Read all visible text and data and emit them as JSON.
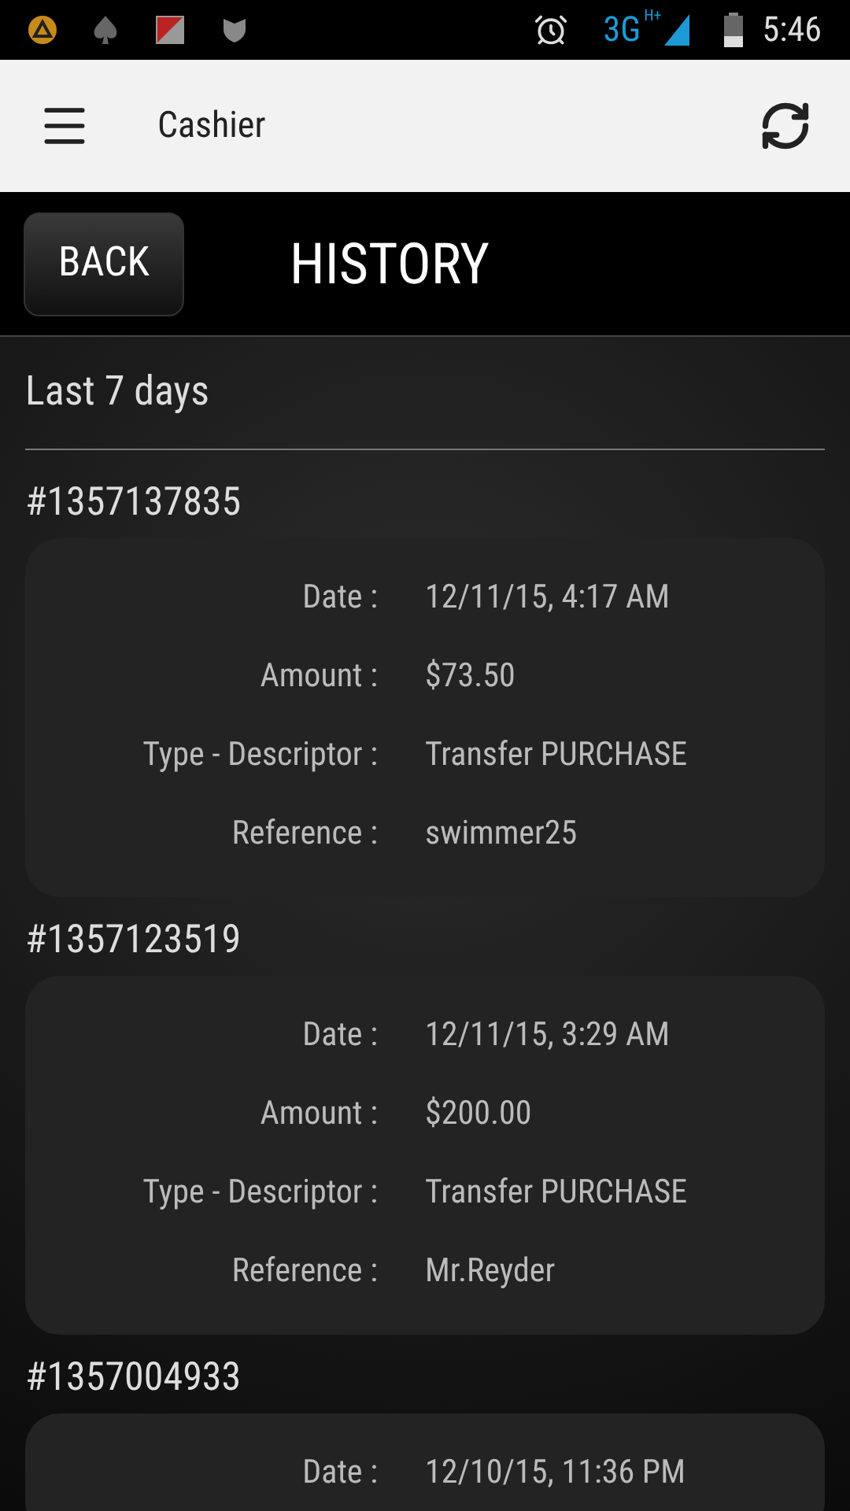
{
  "status_bar": {
    "network": "3G",
    "network_sub": "H+",
    "time": "5:46"
  },
  "app_bar": {
    "title": "Cashier"
  },
  "header": {
    "back": "BACK",
    "title": "HISTORY"
  },
  "section": "Last 7 days",
  "transactions": [
    {
      "id": "#1357137835",
      "fields": [
        {
          "label": "Date :",
          "value": "12/11/15, 4:17 AM"
        },
        {
          "label": "Amount :",
          "value": "$73.50"
        },
        {
          "label": "Type - Descriptor :",
          "value": "Transfer PURCHASE"
        },
        {
          "label": "Reference :",
          "value": "swimmer25"
        }
      ]
    },
    {
      "id": "#1357123519",
      "fields": [
        {
          "label": "Date :",
          "value": "12/11/15, 3:29 AM"
        },
        {
          "label": "Amount :",
          "value": "$200.00"
        },
        {
          "label": "Type - Descriptor :",
          "value": "Transfer PURCHASE"
        },
        {
          "label": "Reference :",
          "value": "Mr.Reyder"
        }
      ]
    },
    {
      "id": "#1357004933",
      "fields": [
        {
          "label": "Date :",
          "value": "12/10/15, 11:36 PM"
        }
      ]
    }
  ]
}
